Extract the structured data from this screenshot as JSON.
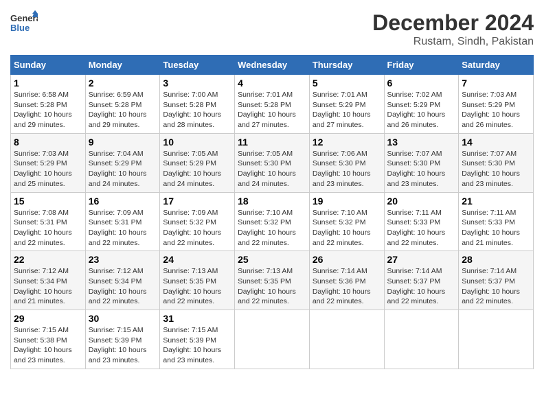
{
  "header": {
    "logo_text_general": "General",
    "logo_text_blue": "Blue",
    "month": "December 2024",
    "location": "Rustam, Sindh, Pakistan"
  },
  "weekdays": [
    "Sunday",
    "Monday",
    "Tuesday",
    "Wednesday",
    "Thursday",
    "Friday",
    "Saturday"
  ],
  "weeks": [
    [
      {
        "day": "1",
        "sunrise": "6:58 AM",
        "sunset": "5:28 PM",
        "daylight": "10 hours and 29 minutes."
      },
      {
        "day": "2",
        "sunrise": "6:59 AM",
        "sunset": "5:28 PM",
        "daylight": "10 hours and 29 minutes."
      },
      {
        "day": "3",
        "sunrise": "7:00 AM",
        "sunset": "5:28 PM",
        "daylight": "10 hours and 28 minutes."
      },
      {
        "day": "4",
        "sunrise": "7:01 AM",
        "sunset": "5:28 PM",
        "daylight": "10 hours and 27 minutes."
      },
      {
        "day": "5",
        "sunrise": "7:01 AM",
        "sunset": "5:29 PM",
        "daylight": "10 hours and 27 minutes."
      },
      {
        "day": "6",
        "sunrise": "7:02 AM",
        "sunset": "5:29 PM",
        "daylight": "10 hours and 26 minutes."
      },
      {
        "day": "7",
        "sunrise": "7:03 AM",
        "sunset": "5:29 PM",
        "daylight": "10 hours and 26 minutes."
      }
    ],
    [
      {
        "day": "8",
        "sunrise": "7:03 AM",
        "sunset": "5:29 PM",
        "daylight": "10 hours and 25 minutes."
      },
      {
        "day": "9",
        "sunrise": "7:04 AM",
        "sunset": "5:29 PM",
        "daylight": "10 hours and 24 minutes."
      },
      {
        "day": "10",
        "sunrise": "7:05 AM",
        "sunset": "5:29 PM",
        "daylight": "10 hours and 24 minutes."
      },
      {
        "day": "11",
        "sunrise": "7:05 AM",
        "sunset": "5:30 PM",
        "daylight": "10 hours and 24 minutes."
      },
      {
        "day": "12",
        "sunrise": "7:06 AM",
        "sunset": "5:30 PM",
        "daylight": "10 hours and 23 minutes."
      },
      {
        "day": "13",
        "sunrise": "7:07 AM",
        "sunset": "5:30 PM",
        "daylight": "10 hours and 23 minutes."
      },
      {
        "day": "14",
        "sunrise": "7:07 AM",
        "sunset": "5:30 PM",
        "daylight": "10 hours and 23 minutes."
      }
    ],
    [
      {
        "day": "15",
        "sunrise": "7:08 AM",
        "sunset": "5:31 PM",
        "daylight": "10 hours and 22 minutes."
      },
      {
        "day": "16",
        "sunrise": "7:09 AM",
        "sunset": "5:31 PM",
        "daylight": "10 hours and 22 minutes."
      },
      {
        "day": "17",
        "sunrise": "7:09 AM",
        "sunset": "5:32 PM",
        "daylight": "10 hours and 22 minutes."
      },
      {
        "day": "18",
        "sunrise": "7:10 AM",
        "sunset": "5:32 PM",
        "daylight": "10 hours and 22 minutes."
      },
      {
        "day": "19",
        "sunrise": "7:10 AM",
        "sunset": "5:32 PM",
        "daylight": "10 hours and 22 minutes."
      },
      {
        "day": "20",
        "sunrise": "7:11 AM",
        "sunset": "5:33 PM",
        "daylight": "10 hours and 22 minutes."
      },
      {
        "day": "21",
        "sunrise": "7:11 AM",
        "sunset": "5:33 PM",
        "daylight": "10 hours and 21 minutes."
      }
    ],
    [
      {
        "day": "22",
        "sunrise": "7:12 AM",
        "sunset": "5:34 PM",
        "daylight": "10 hours and 21 minutes."
      },
      {
        "day": "23",
        "sunrise": "7:12 AM",
        "sunset": "5:34 PM",
        "daylight": "10 hours and 22 minutes."
      },
      {
        "day": "24",
        "sunrise": "7:13 AM",
        "sunset": "5:35 PM",
        "daylight": "10 hours and 22 minutes."
      },
      {
        "day": "25",
        "sunrise": "7:13 AM",
        "sunset": "5:35 PM",
        "daylight": "10 hours and 22 minutes."
      },
      {
        "day": "26",
        "sunrise": "7:14 AM",
        "sunset": "5:36 PM",
        "daylight": "10 hours and 22 minutes."
      },
      {
        "day": "27",
        "sunrise": "7:14 AM",
        "sunset": "5:37 PM",
        "daylight": "10 hours and 22 minutes."
      },
      {
        "day": "28",
        "sunrise": "7:14 AM",
        "sunset": "5:37 PM",
        "daylight": "10 hours and 22 minutes."
      }
    ],
    [
      {
        "day": "29",
        "sunrise": "7:15 AM",
        "sunset": "5:38 PM",
        "daylight": "10 hours and 23 minutes."
      },
      {
        "day": "30",
        "sunrise": "7:15 AM",
        "sunset": "5:39 PM",
        "daylight": "10 hours and 23 minutes."
      },
      {
        "day": "31",
        "sunrise": "7:15 AM",
        "sunset": "5:39 PM",
        "daylight": "10 hours and 23 minutes."
      },
      null,
      null,
      null,
      null
    ]
  ]
}
